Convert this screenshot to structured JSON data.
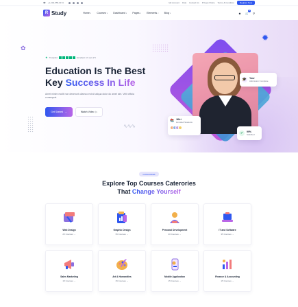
{
  "topbar": {
    "contact": "+1-202-555-0174",
    "links": [
      "My Account",
      "FAQ",
      "Contact Us",
      "Privacy Policy",
      "Terms & Condition"
    ],
    "register": "Register Now"
  },
  "header": {
    "logo_mark": "R",
    "logo_text": "Study",
    "nav": [
      "Home",
      "Courses",
      "Dashboard",
      "Pages",
      "Elements",
      "Blog"
    ]
  },
  "hero": {
    "trustpilot": "Trustpilot",
    "rating": "Excellent 4.9 out of 5",
    "title_line1": "Education Is The Best",
    "title_line2_plain": "Key ",
    "title_line2_highlight": "Success In Life",
    "description": "Amet minim mollit non deserunt ullamco est sit aliqua dolor do amet sint. Velit officia consequat.",
    "primary_button": "Get Started",
    "secondary_button": "Watch Video",
    "card_your_title": "Your",
    "card_your_sub": "Admission Complete",
    "card_courses_title": "36k+",
    "card_courses_sub": "Enrolled Students",
    "card_pass_title": "99%",
    "card_pass_sub": "Satisfied"
  },
  "categories": {
    "badge": "Categories",
    "title_line1": "Explore Top Courses Caterories",
    "title_line2_plain": "That ",
    "title_line2_highlight": "Change Yourself",
    "items": [
      {
        "name": "Web Design",
        "count": "25 Courses",
        "icon": "pencil-ruler-icon"
      },
      {
        "name": "Graphic Design",
        "count": "35 Courses",
        "icon": "clipboard-chart-icon"
      },
      {
        "name": "Personal Development",
        "count": "20 Courses",
        "icon": "trophy-person-icon"
      },
      {
        "name": "IT and Software",
        "count": "35 Courses",
        "icon": "laptop-icon"
      },
      {
        "name": "Sales Marketing",
        "count": "15 Courses",
        "icon": "megaphone-icon"
      },
      {
        "name": "Art & Humanities",
        "count": "15 Courses",
        "icon": "palette-icon"
      },
      {
        "name": "Mobile Application",
        "count": "15 Courses",
        "icon": "phone-app-icon"
      },
      {
        "name": "Finance & Accounting",
        "count": "15 Courses",
        "icon": "chart-bars-icon"
      }
    ]
  }
}
